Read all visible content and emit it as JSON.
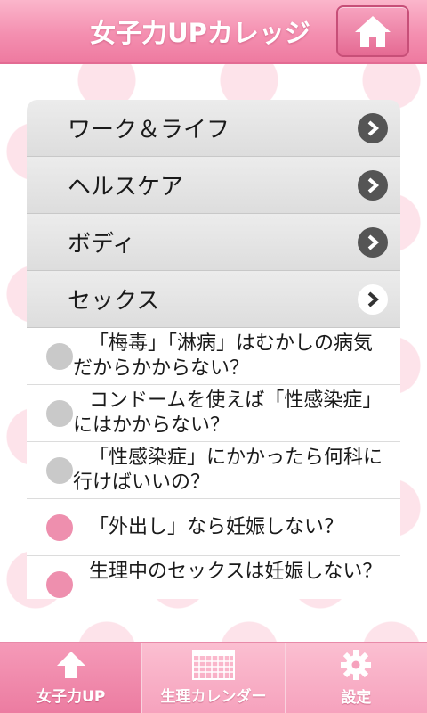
{
  "header": {
    "title": "女子力UPカレッジ",
    "home_icon": "home-icon"
  },
  "categories": [
    {
      "label": "ワーク＆ライフ",
      "icon": "chevron-right-icon"
    },
    {
      "label": "ヘルスケア",
      "icon": "chevron-right-icon"
    },
    {
      "label": "ボディ",
      "icon": "chevron-right-icon"
    },
    {
      "label": "セックス",
      "icon": "chevron-right-icon",
      "expanded": true
    }
  ],
  "sub_items": [
    {
      "text": "「梅毒」「淋病」はむかしの病気だからかからない？",
      "read": true
    },
    {
      "text": "コンドームを使えば「性感染症」にはかからない？",
      "read": true
    },
    {
      "text": "「性感染症」にかかったら何科に行けばいいの？",
      "read": true
    },
    {
      "text": "「外出し」なら妊娠しない？",
      "read": false
    },
    {
      "text": "生理中のセックスは妊娠しない？",
      "read": false
    }
  ],
  "tabs": [
    {
      "label": "女子力UP",
      "icon": "arrow-up-icon",
      "active": true
    },
    {
      "label": "生理カレンダー",
      "icon": "calendar-icon",
      "active": false
    },
    {
      "label": "設定",
      "icon": "gear-icon",
      "active": false
    }
  ],
  "colors": {
    "header_pink": "#f48fb0",
    "bullet_read": "#c9c9c9",
    "bullet_unread": "#ee8fae",
    "arrow_dark": "#555555"
  }
}
